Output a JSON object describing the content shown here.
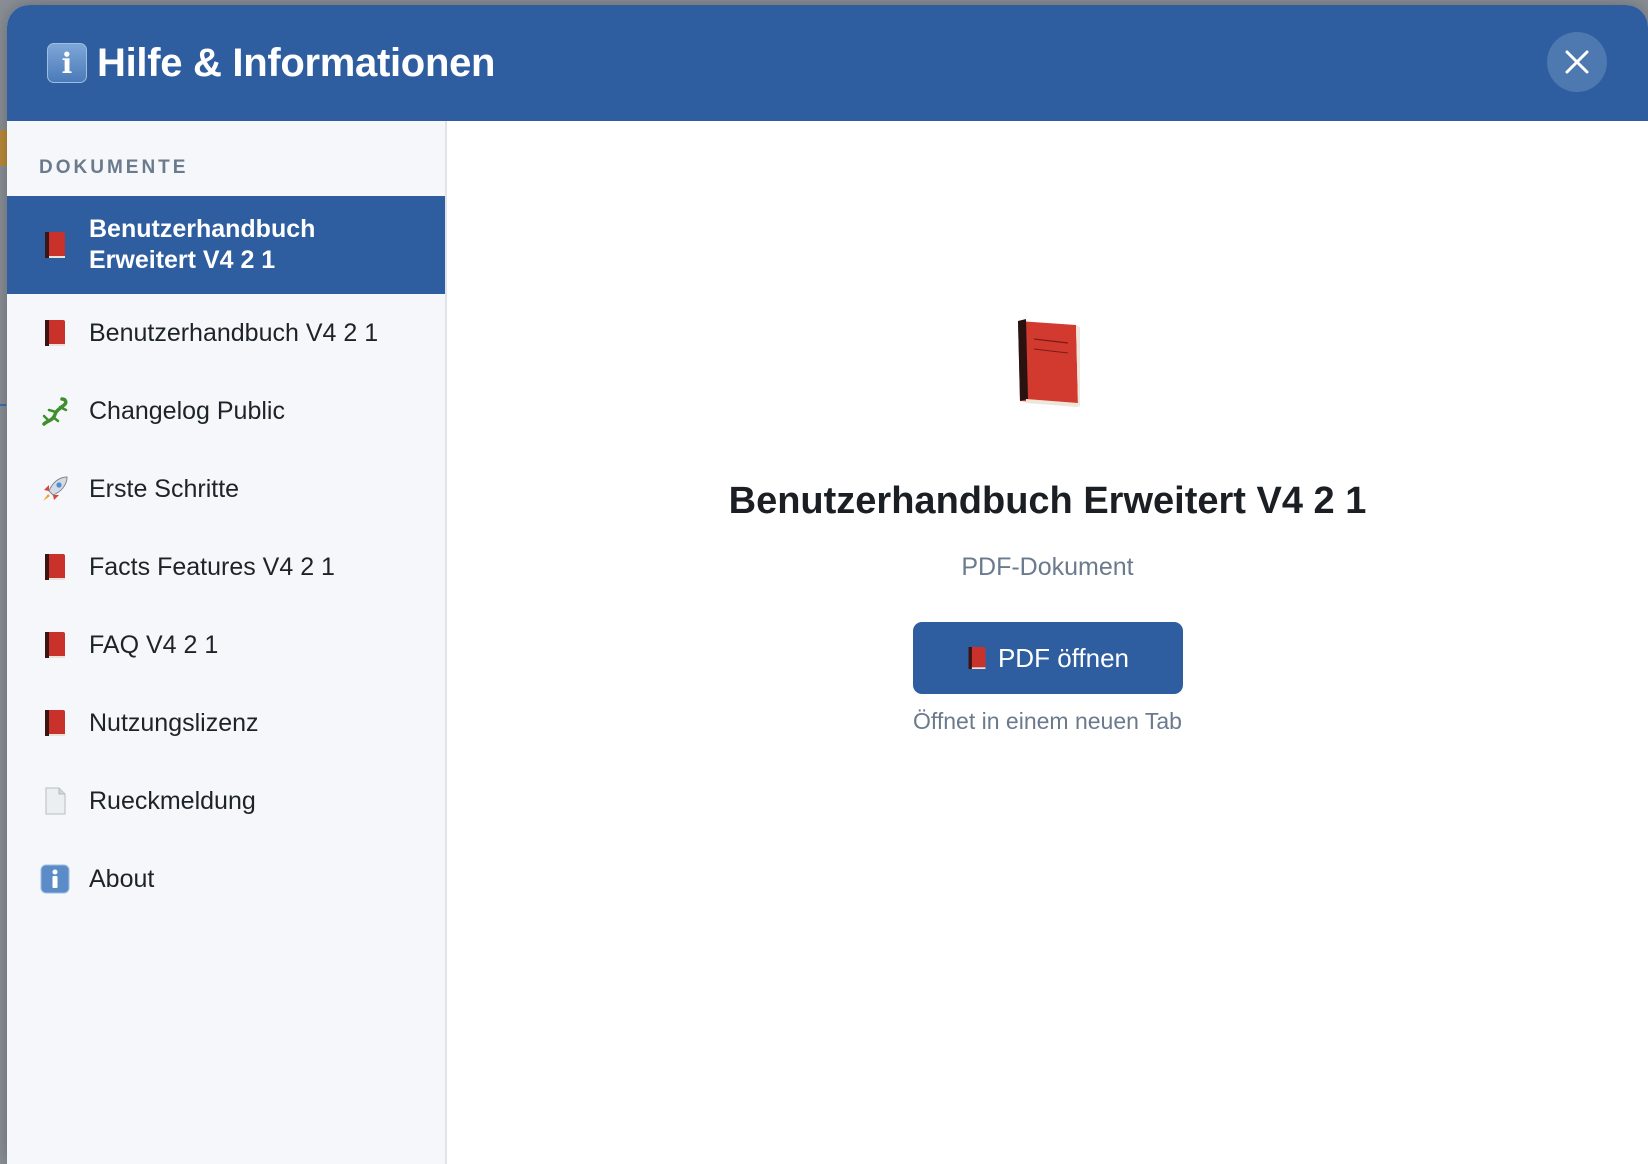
{
  "modal": {
    "title": "Hilfe & Informationen",
    "header_icon": "info-icon",
    "close_icon": "close-icon",
    "accent_color": "#2e5e9f"
  },
  "sidebar": {
    "heading": "DOKUMENTE",
    "items": [
      {
        "label": "Benutzerhandbuch Erweitert V4 2 1",
        "icon": "red-book-icon",
        "active": true
      },
      {
        "label": "Benutzerhandbuch V4 2 1",
        "icon": "red-book-icon",
        "active": false
      },
      {
        "label": "Changelog Public",
        "icon": "lizard-icon",
        "active": false
      },
      {
        "label": "Erste Schritte",
        "icon": "rocket-icon",
        "active": false
      },
      {
        "label": "Facts Features V4 2 1",
        "icon": "red-book-icon",
        "active": false
      },
      {
        "label": "FAQ V4 2 1",
        "icon": "red-book-icon",
        "active": false
      },
      {
        "label": "Nutzungslizenz",
        "icon": "red-book-icon",
        "active": false
      },
      {
        "label": "Rueckmeldung",
        "icon": "document-icon",
        "active": false
      },
      {
        "label": "About",
        "icon": "info-icon",
        "active": false
      }
    ]
  },
  "content": {
    "preview_icon": "red-book-icon",
    "title": "Benutzerhandbuch Erweitert V4 2 1",
    "type": "PDF-Dokument",
    "open_button_label": "PDF öffnen",
    "open_hint": "Öffnet in einem neuen Tab"
  }
}
